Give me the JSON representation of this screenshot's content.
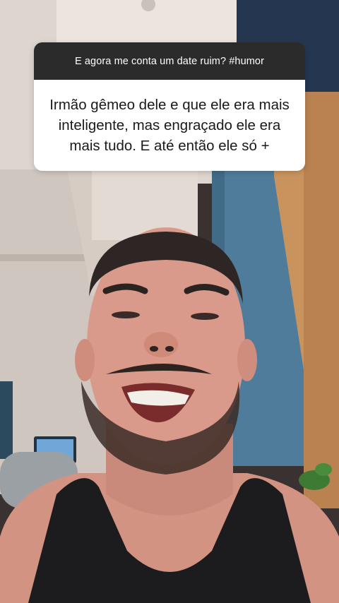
{
  "question_sticker": {
    "question": "E agora me conta um date ruim? #humor",
    "answer": "Irmão gêmeo dele e que ele era mais inteligente, mas engraçado ele era mais tudo. E até então ele só +"
  },
  "colors": {
    "sticker_header_bg": "#2b2b2b",
    "sticker_body_bg": "#ffffff",
    "wall_blue": "#4f7c9a",
    "wood_panel": "#c9935e",
    "tank_top": "#1c1c1e",
    "skin": "#d9988a"
  }
}
